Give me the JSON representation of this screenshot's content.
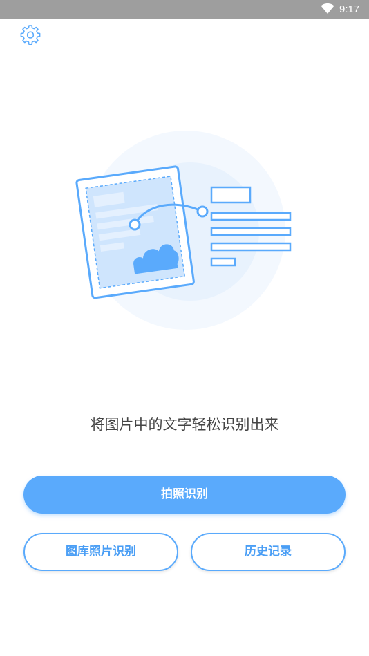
{
  "status_bar": {
    "time": "9:17",
    "wifi_icon": "wifi-icon"
  },
  "header": {
    "settings_icon": "gear-icon"
  },
  "illustration": {
    "name": "document-to-text-illustration",
    "colors": {
      "outer_circle": "#f3f8fe",
      "inner_circle": "#e8f2fd",
      "stroke": "#5aaafc",
      "fill": "#cfe5fd"
    }
  },
  "main": {
    "tagline": "将图片中的文字轻松识别出来"
  },
  "actions": {
    "camera_label": "拍照识别",
    "gallery_label": "图库照片识别",
    "history_label": "历史记录"
  },
  "colors": {
    "accent": "#5aaafc",
    "status_bar": "#9e9e9e"
  }
}
